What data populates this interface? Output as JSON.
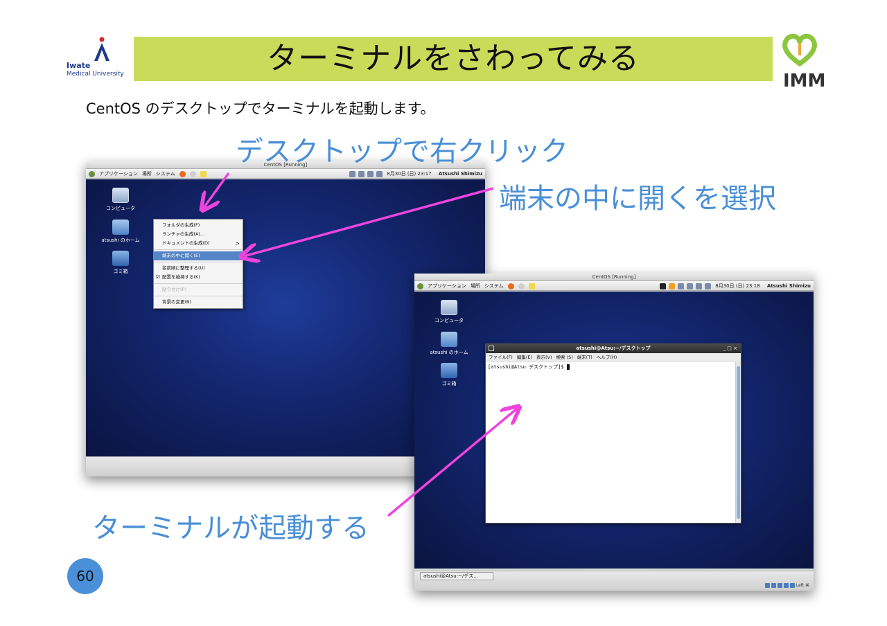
{
  "header": {
    "logo_left_line1": "Iwate",
    "logo_left_line2": "Medical University",
    "title": "ターミナルをさわってみる",
    "logo_right": "IMM"
  },
  "subtitle": "CentOS のデスクトップでターミナルを起動します。",
  "captions": {
    "right_click": "デスクトップで右クリック",
    "open_in_terminal": "端末の中に開くを選択",
    "terminal_starts": "ターミナルが起動する"
  },
  "page_number": "60",
  "vm1": {
    "window_title": "CentOS [Running]",
    "panel": {
      "menus": [
        "アプリケーション",
        "場所",
        "システム"
      ],
      "datetime": "8月30日 (日) 23:17",
      "user": "Atsushi Shimizu"
    },
    "desktop_icons": [
      "コンピュータ",
      "atsushi のホーム",
      "ゴミ箱"
    ],
    "context_menu": {
      "items": [
        {
          "label": "フォルダの生成(F)"
        },
        {
          "label": "ランチャの生成(A)..."
        },
        {
          "label": "ドキュメントの生成(D)",
          "submenu": ">"
        },
        {
          "label": "端末の中に開く(E)",
          "highlighted": true
        },
        {
          "label": "名前順に整理する(U)"
        },
        {
          "label": "配置を維持する(K)",
          "checked": "☑"
        },
        {
          "label": "貼り付け(P)",
          "disabled": true
        },
        {
          "label": "背景の変更(B)"
        }
      ]
    }
  },
  "vm2": {
    "window_title": "CentOS [Running]",
    "panel": {
      "menus": [
        "アプリケーション",
        "場所",
        "システム"
      ],
      "datetime": "8月30日 (日) 23:18",
      "user": "Atsushi Shimizu"
    },
    "desktop_icons": [
      "コンピュータ",
      "atsushi のホーム",
      "ゴミ箱"
    ],
    "terminal": {
      "title": "atsushi@Atsu:~/デスクトップ",
      "controls": "_ □ ×",
      "menus": [
        "ファイル(F)",
        "編集(E)",
        "表示(V)",
        "検索 (S)",
        "端末(T)",
        "ヘルプ(H)"
      ],
      "prompt": "[atsushi@Atsu デスクトップ]$ "
    },
    "taskbar_item": "atsushi@Atsu:~/デス...",
    "status_right": "Left ⌘"
  },
  "colors": {
    "title_bar": "#c8dc5a",
    "caption": "#4a8fd6",
    "arrow": "#ee44dd",
    "page_badge": "#4a90d9"
  }
}
